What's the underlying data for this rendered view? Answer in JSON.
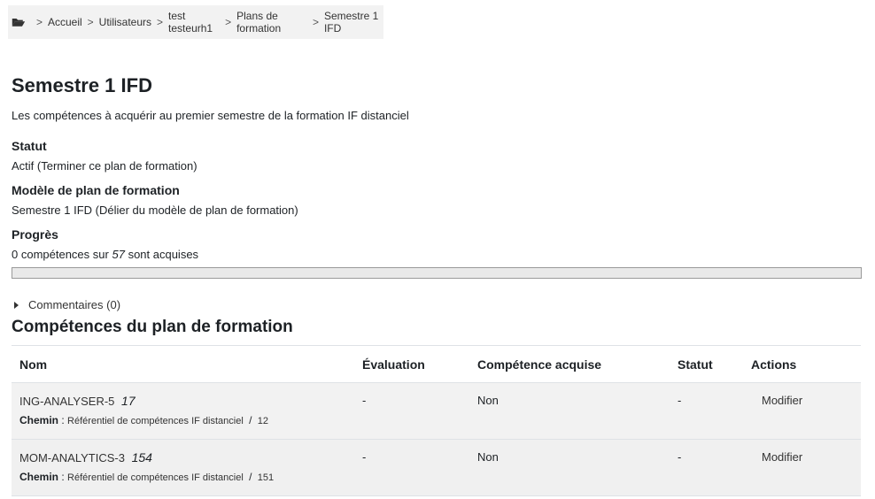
{
  "breadcrumb": {
    "sep": ">",
    "items": [
      "Accueil",
      "Utilisateurs",
      "test testeurh1",
      "Plans de formation",
      "Semestre 1 IFD"
    ]
  },
  "plan": {
    "title": "Semestre 1 IFD",
    "description": "Les compétences à acquérir au premier semestre de la formation IF distanciel",
    "status_label": "Statut",
    "status_value": "Actif",
    "status_action": "(Terminer ce plan de formation)",
    "template_label": "Modèle de plan de formation",
    "template_value": "Semestre 1 IFD",
    "template_action": "(Délier du modèle de plan de formation)",
    "progress_label": "Progrès",
    "progress_text_before": "0 compétences sur",
    "progress_total": "57",
    "progress_text_after": "sont acquises",
    "progress_fraction": 0
  },
  "comments": {
    "label": "Commentaires (0)"
  },
  "competencies": {
    "title": "Compétences du plan de formation",
    "columns": [
      "Nom",
      "Évaluation",
      "Compétence acquise",
      "Statut",
      "Actions"
    ],
    "path_label": "Chemin",
    "path_colon": ":",
    "path_sep": "/",
    "rows": [
      {
        "name": "ING-ANALYSER-5",
        "id": "17",
        "path_framework": "Référentiel de compétences IF distanciel",
        "path_parent": "12",
        "evaluation": "-",
        "acquired": "Non",
        "status": "-",
        "action": "Modifier"
      },
      {
        "name": "MOM-ANALYTICS-3",
        "id": "154",
        "path_framework": "Référentiel de compétences IF distanciel",
        "path_parent": "151",
        "evaluation": "-",
        "acquired": "Non",
        "status": "-",
        "action": "Modifier"
      }
    ]
  },
  "colors": {
    "accent": "#0f6cbf",
    "row_bg": "#f2f2f2",
    "breadcrumb_bg": "#f2f2f2"
  }
}
